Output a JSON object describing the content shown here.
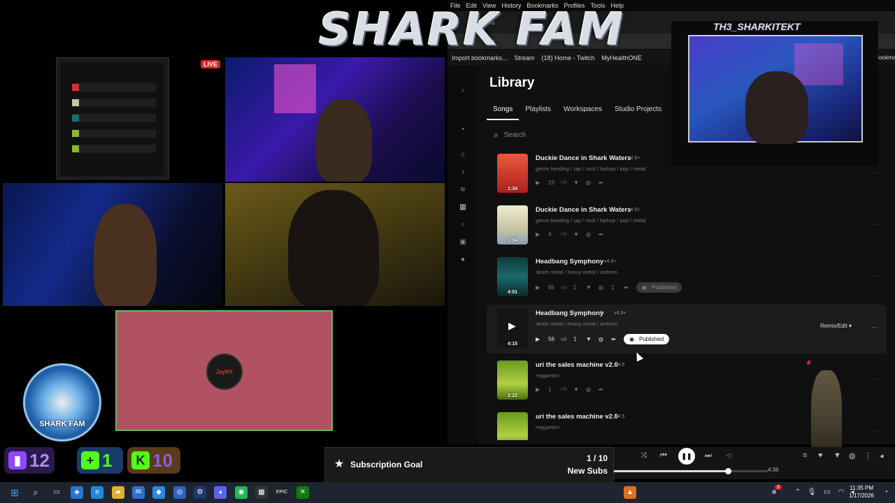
{
  "overlay": {
    "title": "SHARK FAM",
    "live_badge": "LIVE",
    "logo_text": "SHARK FAM",
    "cam_name": "TH3_SHARKITEKT",
    "avatar_label": "JayNY",
    "stats": [
      {
        "platform": "twitch-icon",
        "value": "12",
        "color": "#a98cf0"
      },
      {
        "platform": "kick-icon",
        "value": "1",
        "color": "#53fc18"
      },
      {
        "platform": "kick-icon",
        "value": "10",
        "color": "#8a5cf0"
      }
    ],
    "sub_goal": {
      "title": "Subscription Goal",
      "count": "1 / 10",
      "label": "New Subs",
      "progress": 0.1
    }
  },
  "browser": {
    "menu": [
      "File",
      "Edit",
      "View",
      "History",
      "Bookmarks",
      "Profiles",
      "Tools",
      "Help"
    ],
    "bookmarks": [
      "Import bookmarks...",
      "Stream",
      "(18) Home - Twitch",
      "MyHealthONE"
    ],
    "bookmarks_right": "Bookmarks",
    "tab_partial": "o | AI Mu"
  },
  "library": {
    "title": "Library",
    "tabs": [
      "Songs",
      "Playlists",
      "Workspaces",
      "Studio Projects"
    ],
    "active_tab": "Songs",
    "search_placeholder": "Search",
    "songs": [
      {
        "title": "Duckie Dance in Shark Waters",
        "version": "v4.5+",
        "genre": "genre bending / rap / rock / hiphop / pop / metal",
        "duration": "1:34",
        "plays": "23",
        "likes": "",
        "comments": "",
        "published": false,
        "thumb": "#d43c2c"
      },
      {
        "title": "Duckie Dance in Shark Waters",
        "version": "v4.5+",
        "genre": "genre bending / rap / rock / hiphop / pop / metal",
        "duration": "1:54",
        "plays": "4",
        "likes": "",
        "comments": "",
        "published": false,
        "thumb": "#c8c4a0"
      },
      {
        "title": "Headbang Symphony",
        "version": "v4.5+",
        "genre": "death metal / heavy metal / anthem",
        "duration": "4:01",
        "plays": "85",
        "likes": "1",
        "comments": "1",
        "published": true,
        "thumb": "#1a6a6a"
      },
      {
        "title": "Headbang Symphony",
        "version": "v4.5+",
        "genre": "death metal / heavy metal / anthem",
        "duration": "4:15",
        "plays": "56",
        "likes": "1",
        "comments": "",
        "published": true,
        "thumb": "#151515"
      },
      {
        "title": "uri the sales machine v2.0",
        "version": "v4.5",
        "genre": "reggaeton",
        "duration": "2:22",
        "plays": "1",
        "likes": "",
        "comments": "",
        "published": false,
        "thumb": "#8ab830"
      },
      {
        "title": "uri the sales machine v2.0",
        "version": "v4.5",
        "genre": "reggaeton",
        "duration": "",
        "plays": "",
        "likes": "",
        "comments": "",
        "published": false,
        "thumb": "#8ab830"
      }
    ],
    "published_label": "Published",
    "remix_label": "Remix/Edit"
  },
  "player": {
    "time_end": "4:36",
    "progress": 0.74
  },
  "taskbar": {
    "time": "11:35 PM",
    "date": "1/17/2026",
    "notif_count": "3"
  }
}
